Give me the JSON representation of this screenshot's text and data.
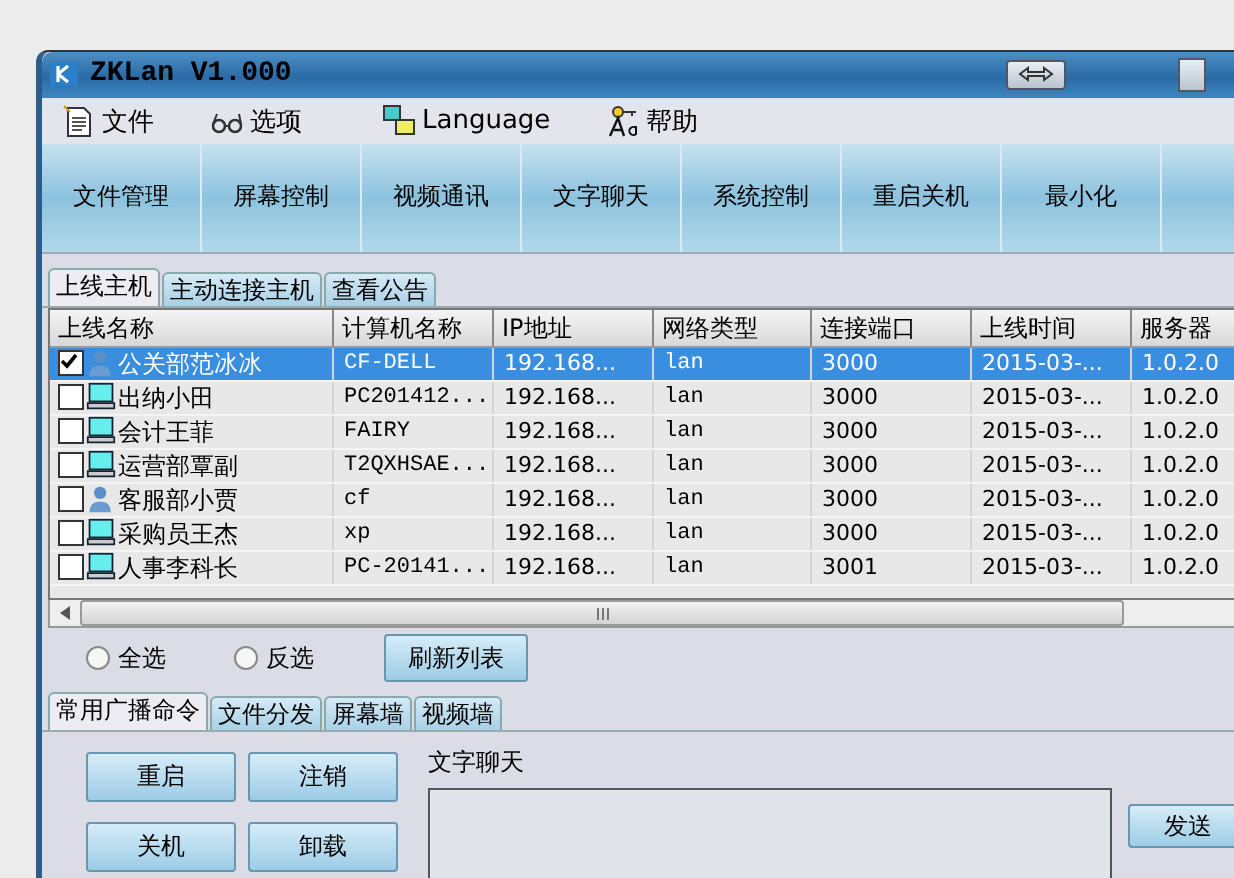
{
  "window": {
    "title": "ZKLan V1.000"
  },
  "menu": [
    {
      "label": "文件",
      "kind": "document"
    },
    {
      "label": "选项",
      "kind": "glasses"
    },
    {
      "label": "Language",
      "kind": "language"
    },
    {
      "label": "帮助",
      "kind": "help"
    }
  ],
  "toolbar": [
    "文件管理",
    "屏幕控制",
    "视频通讯",
    "文字聊天",
    "系统控制",
    "重启关机",
    "最小化"
  ],
  "tabs": [
    {
      "label": "上线主机",
      "selected": true
    },
    {
      "label": "主动连接主机",
      "selected": false
    },
    {
      "label": "查看公告",
      "selected": false
    }
  ],
  "table": {
    "columns": [
      "上线名称",
      "计算机名称",
      "IP地址",
      "网络类型",
      "连接端口",
      "上线时间",
      "服务器"
    ],
    "rows": [
      {
        "checked": true,
        "selected": true,
        "kind": "person",
        "cells": [
          "公关部范冰冰",
          "CF-DELL",
          "192.168...",
          "lan",
          "3000",
          "2015-03-...",
          "1.0.2.0"
        ]
      },
      {
        "checked": false,
        "selected": false,
        "kind": "computer",
        "cells": [
          "出纳小田",
          "PC201412...",
          "192.168...",
          "lan",
          "3000",
          "2015-03-...",
          "1.0.2.0"
        ]
      },
      {
        "checked": false,
        "selected": false,
        "kind": "computer",
        "cells": [
          "会计王菲",
          "FAIRY",
          "192.168...",
          "lan",
          "3000",
          "2015-03-...",
          "1.0.2.0"
        ]
      },
      {
        "checked": false,
        "selected": false,
        "kind": "computer",
        "cells": [
          "运营部覃副",
          "T2QXHSAE...",
          "192.168...",
          "lan",
          "3000",
          "2015-03-...",
          "1.0.2.0"
        ]
      },
      {
        "checked": false,
        "selected": false,
        "kind": "person",
        "cells": [
          "客服部小贾",
          "cf",
          "192.168...",
          "lan",
          "3000",
          "2015-03-...",
          "1.0.2.0"
        ]
      },
      {
        "checked": false,
        "selected": false,
        "kind": "computer",
        "cells": [
          "采购员王杰",
          "xp",
          "192.168...",
          "lan",
          "3000",
          "2015-03-...",
          "1.0.2.0"
        ]
      },
      {
        "checked": false,
        "selected": false,
        "kind": "computer",
        "cells": [
          "人事李科长",
          "PC-20141...",
          "192.168...",
          "lan",
          "3001",
          "2015-03-...",
          "1.0.2.0"
        ]
      }
    ]
  },
  "selection": [
    {
      "label": "全选",
      "selected": false
    },
    {
      "label": "反选",
      "selected": false
    }
  ],
  "refresh_button": "刷新列表",
  "bottom_tabs": [
    {
      "label": "常用广播命令",
      "selected": true
    },
    {
      "label": "文件分发",
      "selected": false
    },
    {
      "label": "屏幕墙",
      "selected": false
    },
    {
      "label": "视频墙",
      "selected": false
    }
  ],
  "commands": [
    "重启",
    "注销",
    "关机",
    "卸载"
  ],
  "chat": {
    "label": "文字聊天",
    "send_button": "发送"
  }
}
